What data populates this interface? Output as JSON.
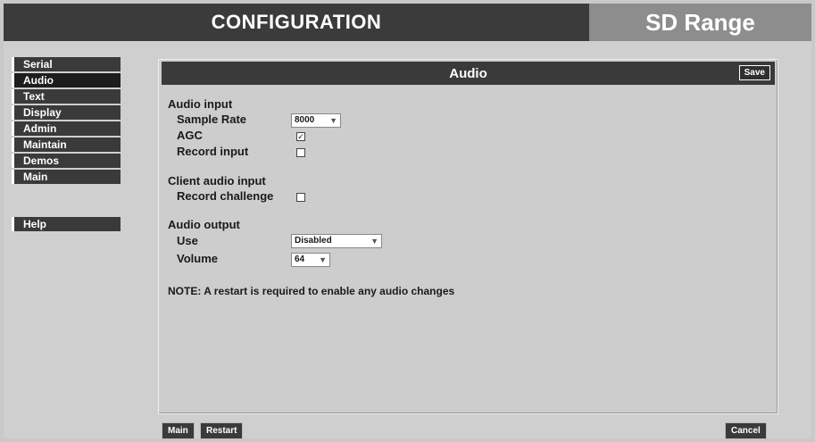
{
  "header": {
    "title": "CONFIGURATION",
    "product": "SD Range"
  },
  "sidebar": {
    "items": [
      {
        "label": "Serial"
      },
      {
        "label": "Audio"
      },
      {
        "label": "Text"
      },
      {
        "label": "Display"
      },
      {
        "label": "Admin"
      },
      {
        "label": "Maintain"
      },
      {
        "label": "Demos"
      },
      {
        "label": "Main"
      }
    ],
    "selected": "Audio",
    "help": "Help"
  },
  "panel": {
    "title": "Audio",
    "save_label": "Save",
    "audio_input": {
      "heading": "Audio input",
      "sample_rate_label": "Sample Rate",
      "sample_rate_value": "8000",
      "agc_label": "AGC",
      "agc_checked": true,
      "record_input_label": "Record input",
      "record_input_checked": false
    },
    "client_audio_input": {
      "heading": "Client audio input",
      "record_challenge_label": "Record challenge",
      "record_challenge_checked": false
    },
    "audio_output": {
      "heading": "Audio output",
      "use_label": "Use",
      "use_value": "Disabled",
      "volume_label": "Volume",
      "volume_value": "64"
    },
    "note": "NOTE: A restart is required to enable any audio changes"
  },
  "footer": {
    "main_label": "Main",
    "restart_label": "Restart",
    "cancel_label": "Cancel"
  }
}
